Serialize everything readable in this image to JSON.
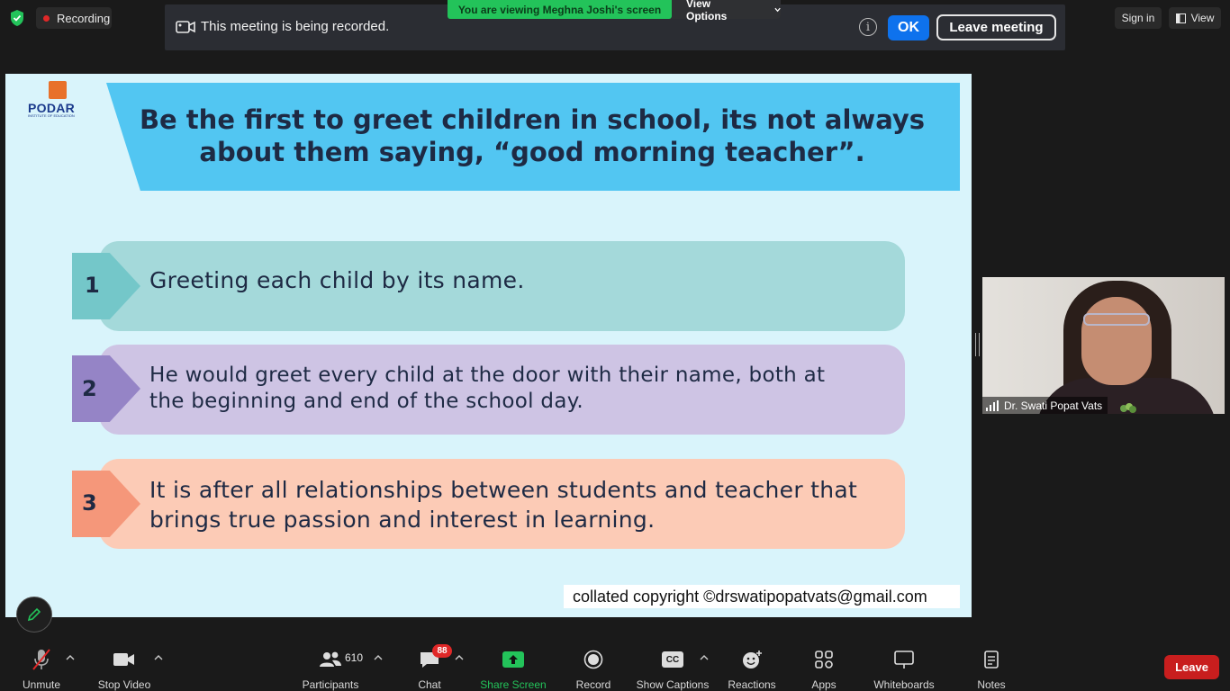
{
  "top": {
    "recording_label": "Recording",
    "banner_text": "This meeting is being recorded.",
    "viewing_text": "You are viewing Meghna Joshi's screen",
    "view_options_label": "View Options",
    "ok_label": "OK",
    "leave_meeting_label": "Leave meeting",
    "sign_in_label": "Sign in",
    "view_label": "View",
    "info_glyph": "i"
  },
  "slide": {
    "logo_name": "PODAR",
    "logo_sub": "INSTITUTE OF EDUCATION",
    "title": "Be the first to greet children in school, its not always about them saying, “good morning teacher”.",
    "items": [
      {
        "number": "1",
        "text": "Greeting each child by its name.",
        "color": "#a4d9da",
        "accent": "#74c7c9"
      },
      {
        "number": "2",
        "text": "He would greet every child at the door with their name, both at the beginning and end of the school day.",
        "color": "#cec4e4",
        "accent": "#9584c6"
      },
      {
        "number": "3",
        "text": "It is after all relationships between students and teacher that brings true passion and interest in learning.",
        "color": "#fccbb6",
        "accent": "#f5977a"
      }
    ],
    "copyright": "collated copyright ©drswatipopatvats@gmail.com"
  },
  "video": {
    "participant_name": "Dr. Swati Popat Vats"
  },
  "toolbar": {
    "unmute_label": "Unmute",
    "stop_video_label": "Stop Video",
    "participants_label": "Participants",
    "participants_count": "610",
    "chat_label": "Chat",
    "chat_badge": "88",
    "share_screen_label": "Share Screen",
    "record_label": "Record",
    "captions_label": "Show Captions",
    "captions_glyph": "CC",
    "reactions_label": "Reactions",
    "apps_label": "Apps",
    "whiteboards_label": "Whiteboards",
    "notes_label": "Notes",
    "leave_label": "Leave"
  },
  "colors": {
    "accent_blue": "#0e72ed",
    "share_green": "#23c35a",
    "leave_red": "#c81e1e",
    "recording_red": "#e02828"
  }
}
